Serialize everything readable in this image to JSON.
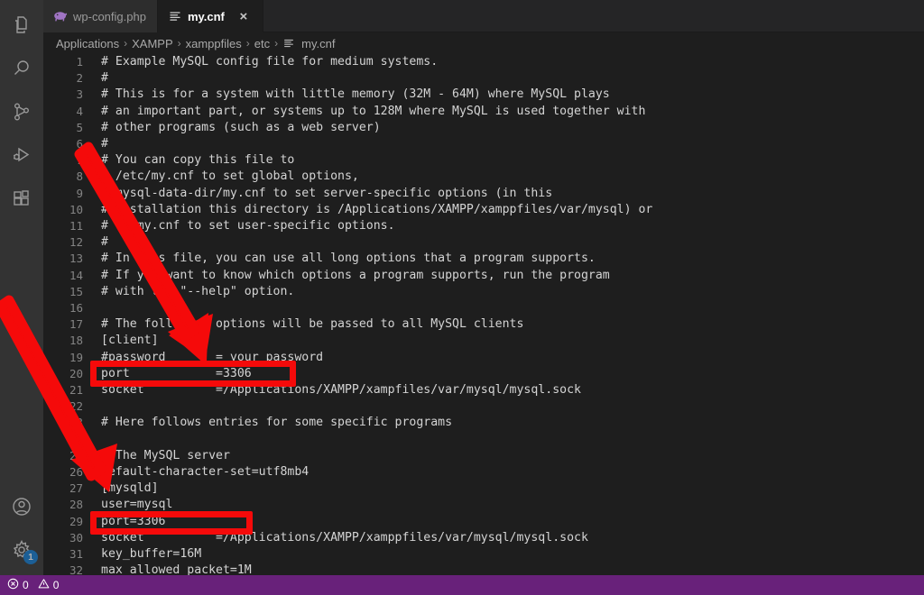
{
  "window": {
    "app": "Visual Studio Code",
    "theme_bg": "#1e1e1e",
    "accent": "#68217a",
    "annotation_color": "#f50a0a"
  },
  "activity_bar": {
    "items": [
      {
        "name": "explorer-icon",
        "label": "Explorer"
      },
      {
        "name": "search-icon",
        "label": "Search"
      },
      {
        "name": "source-control-icon",
        "label": "Source Control"
      },
      {
        "name": "run-and-debug-icon",
        "label": "Run and Debug"
      },
      {
        "name": "extensions-icon",
        "label": "Extensions"
      }
    ],
    "bottom_items": [
      {
        "name": "account-icon",
        "label": "Accounts",
        "badge": ""
      },
      {
        "name": "gear-icon",
        "label": "Manage",
        "badge": "1"
      }
    ]
  },
  "tabs": [
    {
      "label": "wp-config.php",
      "icon": "php-elephant-icon",
      "active": false,
      "closable": false
    },
    {
      "label": "my.cnf",
      "icon": "config-file-icon",
      "active": true,
      "closable": true,
      "close_label": "×"
    }
  ],
  "breadcrumb": {
    "separator": "›",
    "items": [
      "Applications",
      "XAMPP",
      "xamppfiles",
      "etc"
    ],
    "file": "my.cnf",
    "file_icon": "config-file-icon"
  },
  "editor": {
    "first_line_number": 1,
    "lines": [
      {
        "n": "1",
        "text": "# Example MySQL config file for medium systems."
      },
      {
        "n": "2",
        "text": "#"
      },
      {
        "n": "3",
        "text": "# This is for a system with little memory (32M - 64M) where MySQL plays"
      },
      {
        "n": "4",
        "text": "# an important part, or systems up to 128M where MySQL is used together with"
      },
      {
        "n": "5",
        "text": "# other programs (such as a web server)"
      },
      {
        "n": "6",
        "text": "#"
      },
      {
        "n": "7",
        "text": "# You can copy this file to"
      },
      {
        "n": "8",
        "text": "# /etc/my.cnf to set global options,"
      },
      {
        "n": "9",
        "text": "# mysql-data-dir/my.cnf to set server-specific options (in this"
      },
      {
        "n": "10",
        "text": "# installation this directory is /Applications/XAMPP/xamppfiles/var/mysql) or"
      },
      {
        "n": "11",
        "text": "# ~/.my.cnf to set user-specific options."
      },
      {
        "n": "12",
        "text": "#"
      },
      {
        "n": "13",
        "text": "# In this file, you can use all long options that a program supports."
      },
      {
        "n": "14",
        "text": "# If you want to know which options a program supports, run the program"
      },
      {
        "n": "15",
        "text": "# with the \"--help\" option."
      },
      {
        "n": "16",
        "text": ""
      },
      {
        "n": "17",
        "text": "# The following options will be passed to all MySQL clients"
      },
      {
        "n": "18",
        "text": "[client]"
      },
      {
        "n": "19",
        "text": "#password       = your_password"
      },
      {
        "n": "20",
        "text": "port            =3306"
      },
      {
        "n": "21",
        "text": "socket          =/Applications/XAMPP/xampfiles/var/mysql/mysql.sock"
      },
      {
        "n": "22",
        "text": ""
      },
      {
        "n": "23",
        "text": "# Here follows entries for some specific programs"
      },
      {
        "n": "24",
        "text": ""
      },
      {
        "n": "25",
        "text": "# The MySQL server"
      },
      {
        "n": "26",
        "text": "default-character-set=utf8mb4"
      },
      {
        "n": "27",
        "text": "[mysqld]"
      },
      {
        "n": "28",
        "text": "user=mysql"
      },
      {
        "n": "29",
        "text": "port=3306"
      },
      {
        "n": "30",
        "text": "socket          =/Applications/XAMPP/xamppfiles/var/mysql/mysql.sock"
      },
      {
        "n": "31",
        "text": "key_buffer=16M"
      },
      {
        "n": "32",
        "text": "max_allowed_packet=1M"
      }
    ]
  },
  "status_bar": {
    "error_icon": "error-circle-icon",
    "error_count": "0",
    "warning_icon": "warning-triangle-icon",
    "warning_count": "0"
  },
  "annotations": {
    "highlight_boxes": [
      {
        "name": "client-port-highlight",
        "target_line": "20",
        "target_text": "port            =3306"
      },
      {
        "name": "mysqld-port-highlight",
        "target_line": "29",
        "target_text": "port=3306"
      }
    ],
    "arrows": [
      {
        "name": "arrow-to-client-port",
        "points_to_line": "20"
      },
      {
        "name": "arrow-to-mysqld-port",
        "points_to_line": "29"
      }
    ]
  }
}
